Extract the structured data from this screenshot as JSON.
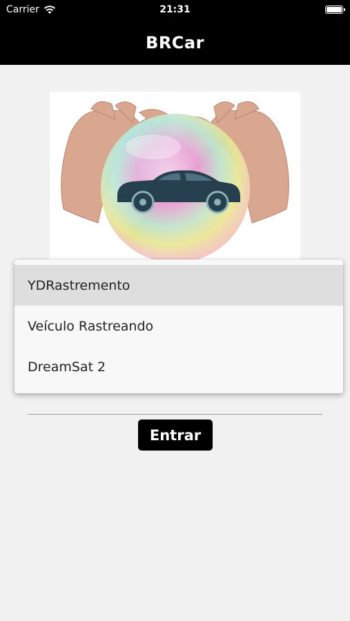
{
  "status_bar": {
    "carrier": "Carrier",
    "time": "21:31",
    "wifi_icon": "wifi-icon",
    "battery_icon": "battery-icon"
  },
  "nav": {
    "title": "BRCar"
  },
  "hero": {
    "image": "car-insurance-bubble-hands",
    "colors": {
      "car": "#26404f",
      "skin": "#d9a790"
    }
  },
  "dropdown": {
    "selected": "YDRastremento",
    "options": [
      "YDRastremento",
      "Veículo Rastreando",
      "DreamSat 2"
    ]
  },
  "actions": {
    "enter_label": "Entrar"
  },
  "colors": {
    "bar": "#000000",
    "background": "#f1f1f1",
    "selected_option": "#dedede"
  }
}
